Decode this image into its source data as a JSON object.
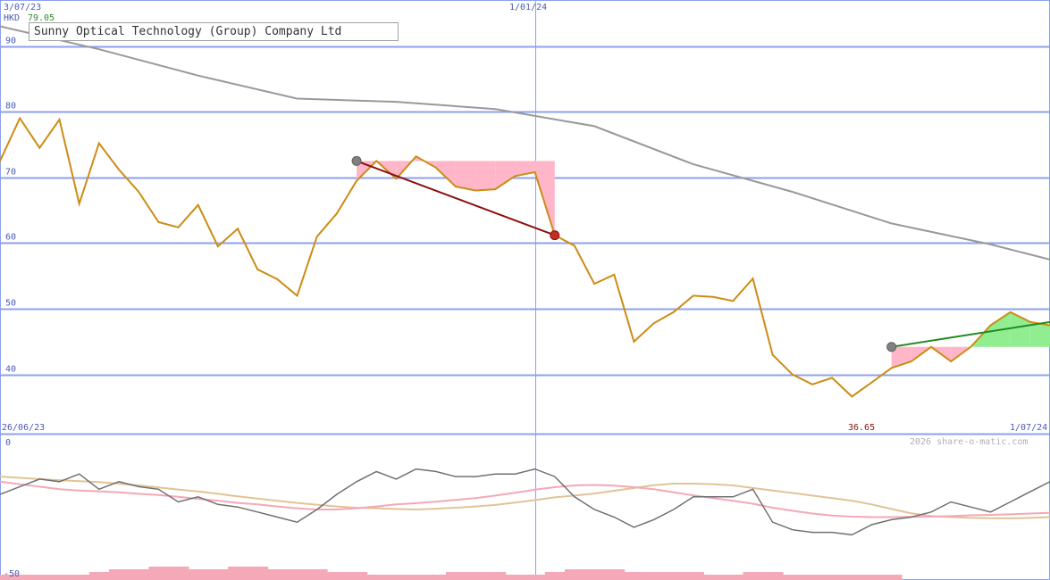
{
  "header": {
    "start_date": "3/07/23",
    "currency": "HKD",
    "last_price": "79.05",
    "mid_date": "1/01/24",
    "title": "Sunny Optical Technology (Group) Company Ltd"
  },
  "footer": {
    "start_date": "26/06/23",
    "end_date": "1/07/24",
    "low_price": "36.65",
    "credit": "2026 share-o-matic.com"
  },
  "colors": {
    "grid": "#8ca0ee",
    "price": "#cc8c14",
    "ma_long": "#999999",
    "down_fill": "#ffb6c8",
    "up_fill": "#90ee90",
    "down_line": "#8b1010",
    "up_line": "#228b22",
    "osc_price": "#707070",
    "osc_pink": "#f4a8b8",
    "osc_tan": "#e0c496",
    "volume": "#f4a8b8"
  },
  "chart_data": [
    {
      "type": "line",
      "title": "Sunny Optical Technology (Group) Company Ltd",
      "ylim": [
        31.0,
        97.0
      ],
      "y_ticks": [
        "40",
        "50",
        "60",
        "70",
        "80",
        "90"
      ],
      "y_tick_values": [
        40,
        50,
        60,
        70,
        80,
        90
      ],
      "x_labels": [
        "26/06/23",
        "1/01/24",
        "1/07/24"
      ],
      "x_range": [
        "2023-06-26",
        "2024-07-01"
      ],
      "grid": true,
      "series": [
        {
          "key": "price",
          "x": [
            "2023-06-26",
            "2023-07-03",
            "2023-07-10",
            "2023-07-17",
            "2023-07-24",
            "2023-07-31",
            "2023-08-07",
            "2023-08-14",
            "2023-08-21",
            "2023-08-28",
            "2023-09-04",
            "2023-09-11",
            "2023-09-18",
            "2023-09-25",
            "2023-10-02",
            "2023-10-09",
            "2023-10-16",
            "2023-10-23",
            "2023-10-30",
            "2023-11-06",
            "2023-11-13",
            "2023-11-20",
            "2023-11-27",
            "2023-12-04",
            "2023-12-11",
            "2023-12-18",
            "2023-12-25",
            "2024-01-01",
            "2024-01-08",
            "2024-01-15",
            "2024-01-22",
            "2024-01-29",
            "2024-02-05",
            "2024-02-12",
            "2024-02-19",
            "2024-02-26",
            "2024-03-04",
            "2024-03-11",
            "2024-03-18",
            "2024-03-25",
            "2024-04-01",
            "2024-04-08",
            "2024-04-15",
            "2024-04-22",
            "2024-04-29",
            "2024-05-06",
            "2024-05-13",
            "2024-05-20",
            "2024-05-27",
            "2024-06-03",
            "2024-06-10",
            "2024-06-17",
            "2024-06-24",
            "2024-07-01"
          ],
          "y": [
            72.5,
            79.0,
            74.5,
            78.8,
            66.0,
            75.2,
            71.2,
            67.8,
            63.2,
            62.4,
            65.8,
            59.5,
            62.2,
            56.0,
            54.5,
            52.0,
            61.0,
            64.5,
            69.5,
            72.5,
            69.8,
            73.2,
            71.5,
            68.6,
            68.0,
            68.2,
            70.2,
            70.8,
            61.2,
            59.6,
            53.8,
            55.2,
            45.0,
            47.8,
            49.5,
            52.0,
            51.8,
            51.2,
            54.6,
            43.0,
            40.0,
            38.5,
            39.5,
            36.65,
            38.8,
            41.0,
            42.0,
            44.2,
            42.0,
            44.2,
            47.5,
            49.5,
            48.0,
            47.5
          ]
        },
        {
          "key": "ma_long",
          "x": [
            "2023-06-26",
            "2023-07-31",
            "2023-09-04",
            "2023-10-09",
            "2023-11-13",
            "2023-12-18",
            "2024-01-22",
            "2024-02-26",
            "2024-04-01",
            "2024-05-06",
            "2024-06-10",
            "2024-07-01"
          ],
          "y": [
            93.0,
            89.5,
            85.5,
            82.0,
            81.5,
            80.4,
            77.8,
            72.0,
            67.8,
            63.0,
            59.8,
            57.5
          ]
        }
      ],
      "annotations": [
        {
          "type": "trend",
          "direction": "down",
          "from": [
            "2023-10-30",
            72.5
          ],
          "to": [
            "2024-01-08",
            61.2
          ]
        },
        {
          "type": "trend",
          "direction": "up",
          "from": [
            "2024-05-06",
            44.2
          ],
          "to": [
            "2024-07-01",
            48.0
          ]
        }
      ]
    },
    {
      "type": "line",
      "y_ticks": [
        "0",
        "-50"
      ],
      "ylim": [
        -50,
        0
      ],
      "grid": false,
      "series": [
        {
          "key": "osc_price",
          "y": [
            -19,
            -16,
            -13,
            -14,
            -11,
            -17,
            -14,
            -16,
            -17,
            -22,
            -20,
            -23,
            -24,
            -26,
            -28,
            -30,
            -25,
            -19,
            -14,
            -10,
            -13,
            -9,
            -10,
            -12,
            -12,
            -11,
            -11,
            -9,
            -12,
            -20,
            -25,
            -28,
            -32,
            -29,
            -25,
            -20,
            -20,
            -20,
            -17,
            -30,
            -33,
            -34,
            -34,
            -35,
            -31,
            -29,
            -28,
            -26,
            -22,
            -24,
            -26,
            -22,
            -18,
            -14
          ]
        },
        {
          "key": "osc_pink",
          "y": [
            -14.0,
            -15.0,
            -16.0,
            -17.0,
            -17.5,
            -17.8,
            -18.2,
            -18.8,
            -19.3,
            -20.0,
            -20.8,
            -21.5,
            -22.4,
            -23.0,
            -23.8,
            -24.5,
            -25.0,
            -25.0,
            -24.5,
            -23.8,
            -23.0,
            -22.5,
            -21.9,
            -21.2,
            -20.5,
            -19.5,
            -18.4,
            -17.2,
            -16.2,
            -15.5,
            -15.3,
            -15.6,
            -16.2,
            -17.0,
            -18.2,
            -19.4,
            -20.5,
            -21.6,
            -22.7,
            -24.3,
            -25.5,
            -26.6,
            -27.4,
            -27.8,
            -28.0,
            -28.0,
            -27.9,
            -27.8,
            -27.6,
            -27.3,
            -27.1,
            -26.9,
            -26.6,
            -26.3
          ]
        },
        {
          "key": "osc_tan",
          "y": [
            -12.0,
            -12.5,
            -13.0,
            -13.4,
            -13.8,
            -14.2,
            -14.8,
            -15.5,
            -16.3,
            -17.1,
            -17.9,
            -18.8,
            -19.8,
            -20.7,
            -21.6,
            -22.4,
            -23.1,
            -23.8,
            -24.3,
            -24.5,
            -24.8,
            -25.0,
            -24.7,
            -24.3,
            -23.8,
            -23.2,
            -22.3,
            -21.3,
            -20.2,
            -19.5,
            -18.7,
            -17.6,
            -16.5,
            -15.4,
            -14.8,
            -14.8,
            -15.0,
            -15.5,
            -16.5,
            -17.5,
            -18.5,
            -19.5,
            -20.5,
            -21.5,
            -23.0,
            -24.8,
            -26.5,
            -27.6,
            -28.0,
            -28.3,
            -28.4,
            -28.5,
            -28.3,
            -28.0
          ]
        },
        {
          "key": "volume",
          "y": [
            1.0,
            1.0,
            1.0,
            1.0,
            1.0,
            1.5,
            2.0,
            2.0,
            2.5,
            2.5,
            2.0,
            2.0,
            2.5,
            2.5,
            2.0,
            2.0,
            2.0,
            1.5,
            1.5,
            1.0,
            1.0,
            1.0,
            1.0,
            1.5,
            1.5,
            1.5,
            1.0,
            1.0,
            1.5,
            2.0,
            2.0,
            2.0,
            1.5,
            1.5,
            1.5,
            1.5,
            1.0,
            1.0,
            1.5,
            1.5,
            1.0,
            1.0,
            1.0,
            1.0,
            1.0,
            1.0,
            0,
            0,
            0,
            0,
            0,
            0,
            0,
            0
          ]
        }
      ]
    }
  ]
}
